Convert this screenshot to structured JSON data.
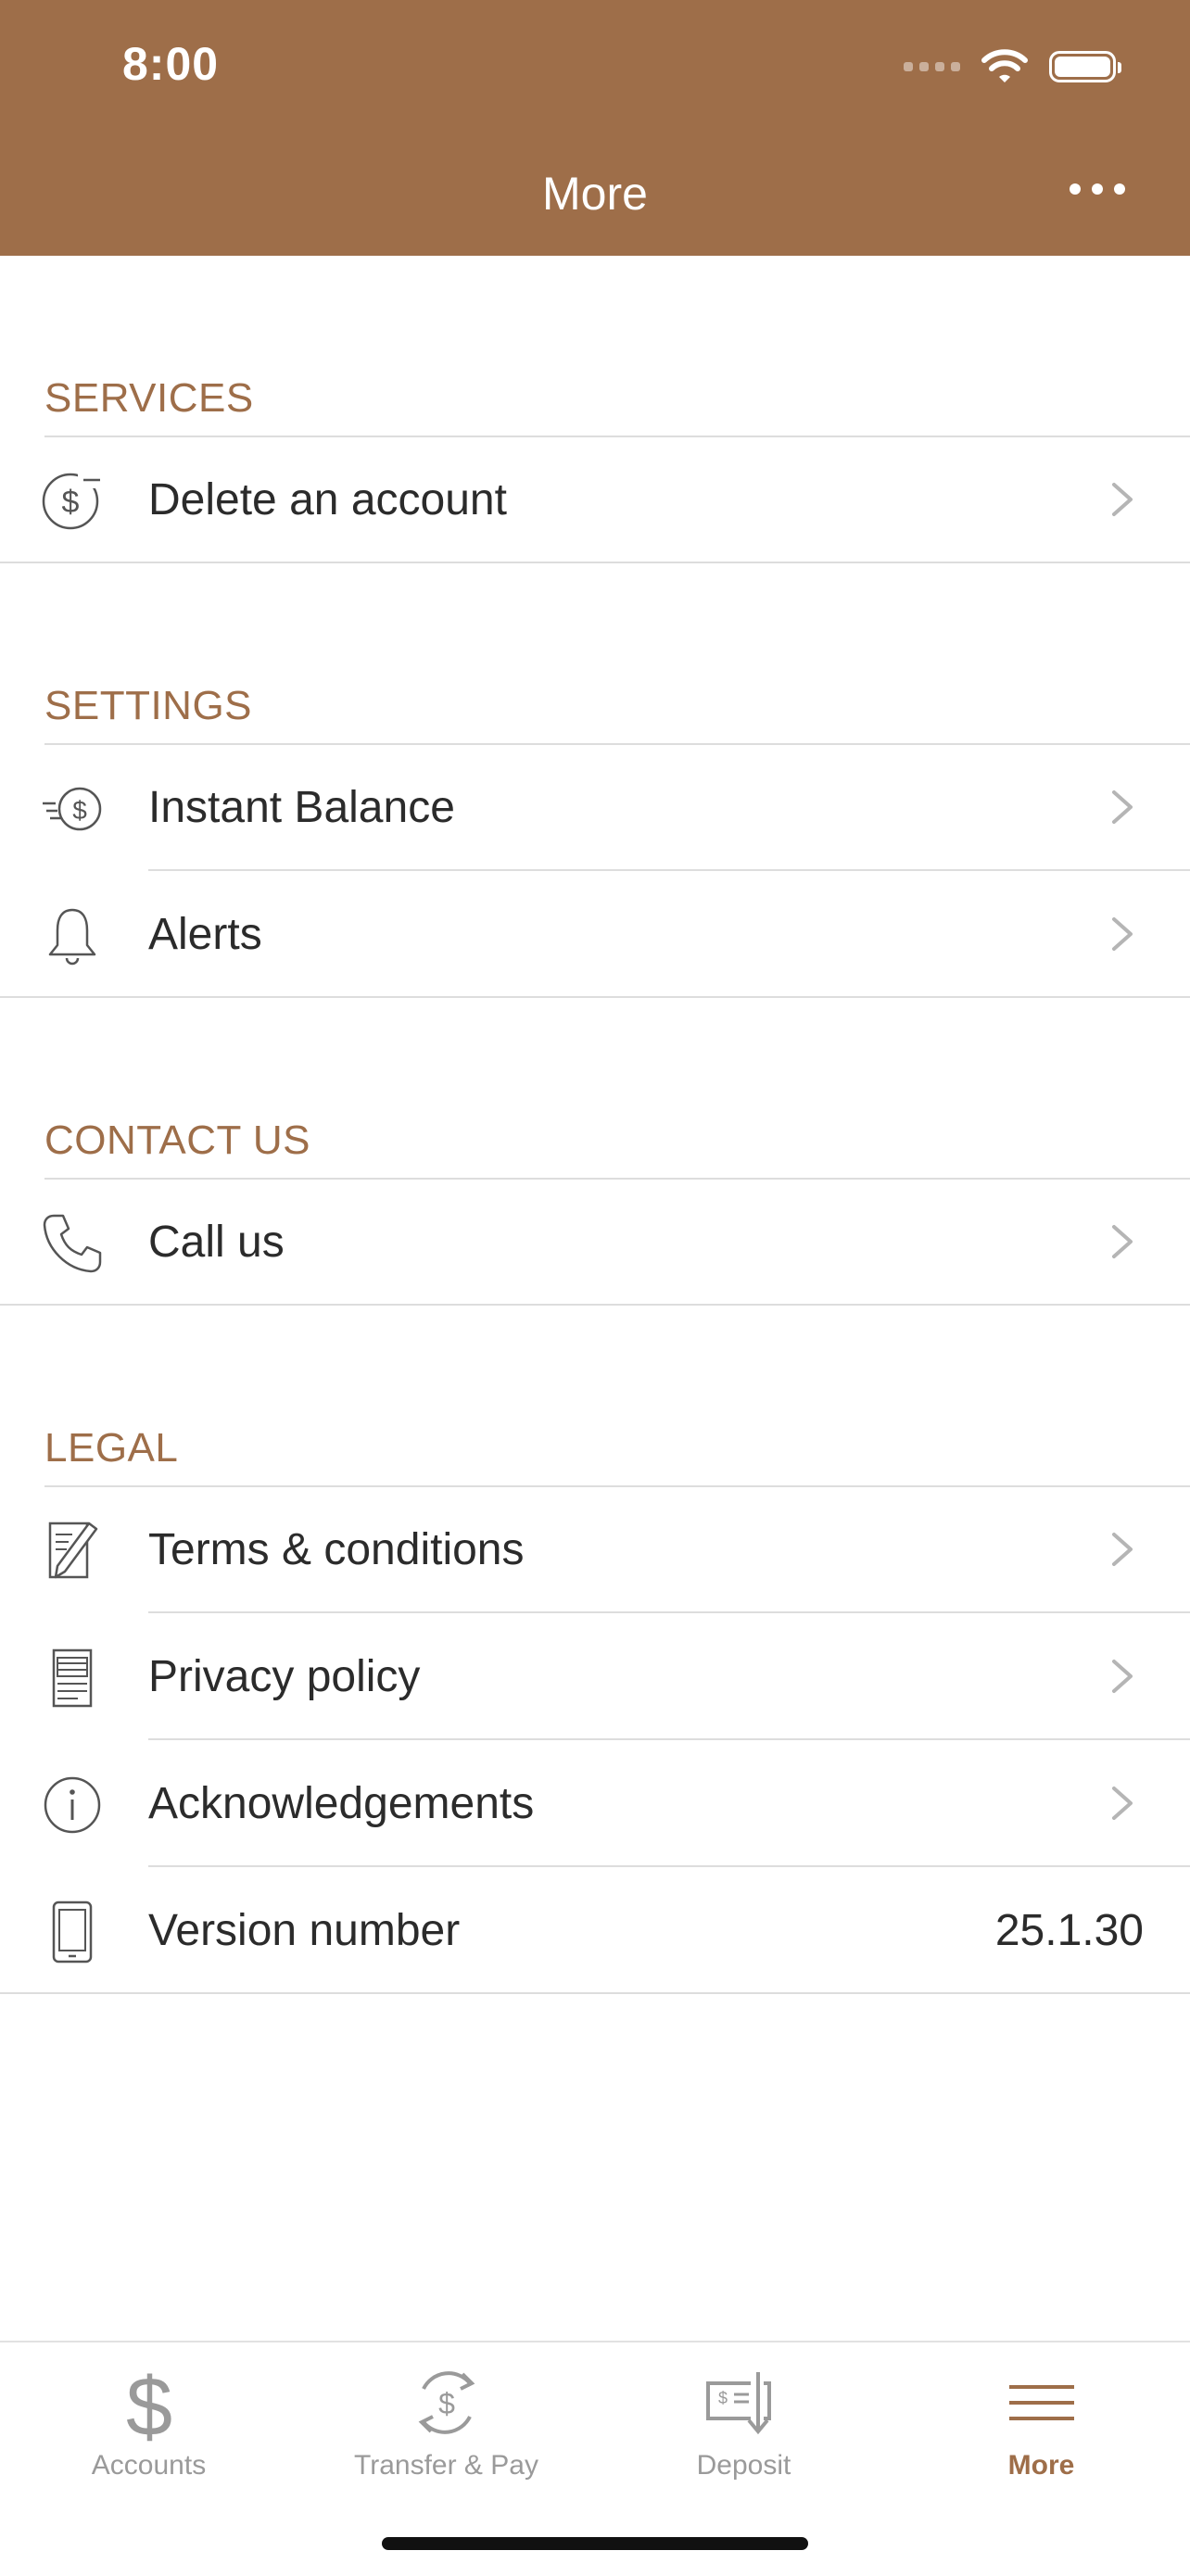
{
  "status_bar": {
    "time": "8:00"
  },
  "header": {
    "title": "More"
  },
  "sections": [
    {
      "label": "SERVICES",
      "items": [
        {
          "label": "Delete an account",
          "icon": "dollar-minus-icon"
        }
      ]
    },
    {
      "label": "SETTINGS",
      "items": [
        {
          "label": "Instant Balance",
          "icon": "fast-dollar-icon"
        },
        {
          "label": "Alerts",
          "icon": "bell-icon"
        }
      ]
    },
    {
      "label": "CONTACT US",
      "items": [
        {
          "label": "Call us",
          "icon": "phone-icon"
        }
      ]
    },
    {
      "label": "LEGAL",
      "items": [
        {
          "label": "Terms & conditions",
          "icon": "document-pen-icon"
        },
        {
          "label": "Privacy policy",
          "icon": "document-icon"
        },
        {
          "label": "Acknowledgements",
          "icon": "info-icon"
        },
        {
          "label": "Version number",
          "icon": "phone-device-icon",
          "value": "25.1.30"
        }
      ]
    }
  ],
  "tabbar": {
    "tabs": [
      {
        "label": "Accounts",
        "icon": "dollar-icon"
      },
      {
        "label": "Transfer & Pay",
        "icon": "transfer-icon"
      },
      {
        "label": "Deposit",
        "icon": "check-deposit-icon"
      },
      {
        "label": "More",
        "icon": "menu-icon",
        "active": true
      }
    ]
  },
  "colors": {
    "brand": "#9e6e49",
    "text": "#2b2b2b",
    "separator": "#dddddd",
    "inactive_tab": "#9a9a9a"
  }
}
